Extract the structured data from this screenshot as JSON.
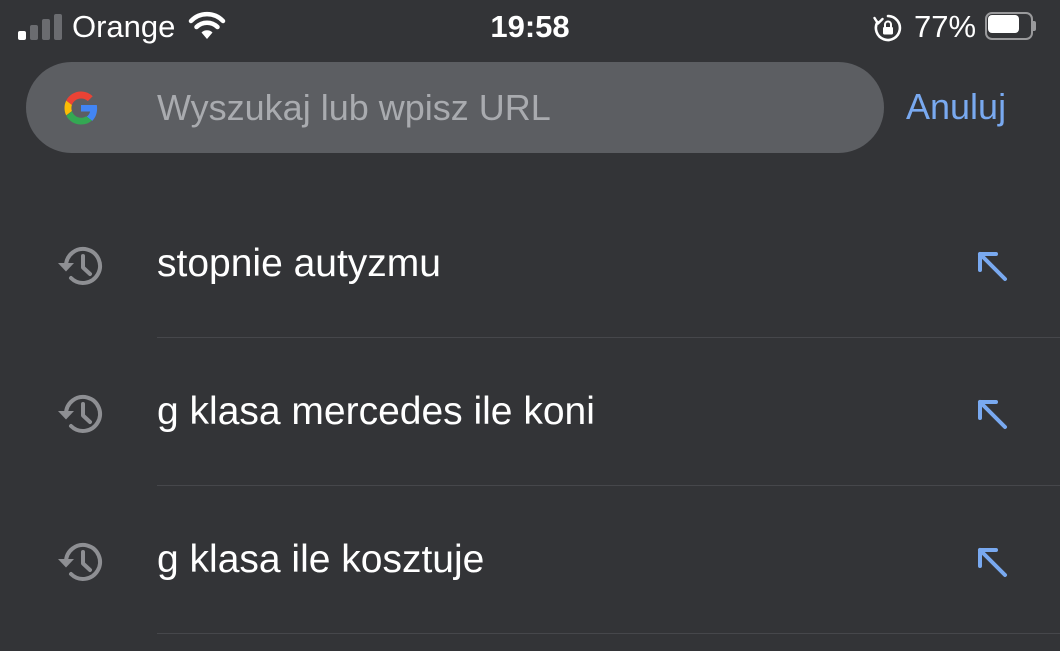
{
  "status_bar": {
    "carrier": "Orange",
    "time": "19:58",
    "battery_percent": "77%",
    "battery_level": 0.77,
    "signal_bars_filled": 1,
    "signal_bars_total": 4,
    "icons": [
      "signal-icon",
      "wifi-icon",
      "rotation-lock-icon",
      "battery-icon"
    ]
  },
  "search": {
    "placeholder": "Wyszukaj lub wpisz URL",
    "value": "",
    "logo_icon": "google-logo-icon"
  },
  "cancel_label": "Anuluj",
  "suggestions": [
    {
      "text": "stopnie autyzmu",
      "icon": "history-icon",
      "action_icon": "fill-arrow-icon"
    },
    {
      "text": "g klasa mercedes ile koni",
      "icon": "history-icon",
      "action_icon": "fill-arrow-icon"
    },
    {
      "text": "g klasa ile kosztuje",
      "icon": "history-icon",
      "action_icon": "fill-arrow-icon"
    }
  ],
  "colors": {
    "background": "#333437",
    "search_bar": "#5c5e62",
    "accent": "#79a9f0",
    "text": "#ffffff",
    "placeholder": "#a9abaf",
    "icon_gray": "#8e8f93"
  }
}
